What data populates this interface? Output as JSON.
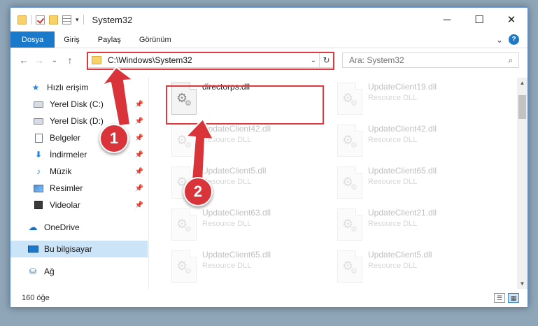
{
  "window": {
    "title": "System32",
    "controls": {
      "minimize": "─",
      "maximize": "☐",
      "close": "✕"
    }
  },
  "ribbon": {
    "tabs": [
      {
        "label": "Dosya"
      },
      {
        "label": "Giriş"
      },
      {
        "label": "Paylaş"
      },
      {
        "label": "Görünüm"
      }
    ],
    "expand_glyph": "⌄",
    "help_glyph": "?"
  },
  "nav": {
    "back": "←",
    "forward": "→",
    "recent": "⌄",
    "up": "↑",
    "address": "C:\\Windows\\System32",
    "address_dropdown": "⌄",
    "refresh": "↻",
    "search_placeholder": "Ara: System32",
    "search_glyph": "⌕"
  },
  "sidebar": {
    "items": [
      {
        "label": "Hızlı erişim",
        "icon": "star-icon",
        "glyph": "★"
      },
      {
        "label": "Yerel Disk (C:)",
        "icon": "disk-icon",
        "pinned": true
      },
      {
        "label": "Yerel Disk (D:)",
        "icon": "disk-icon",
        "pinned": true
      },
      {
        "label": "Belgeler",
        "icon": "document-icon",
        "pinned": true
      },
      {
        "label": "İndirmeler",
        "icon": "download-icon",
        "glyph": "⬇",
        "pinned": true
      },
      {
        "label": "Müzik",
        "icon": "music-icon",
        "glyph": "♪",
        "pinned": true
      },
      {
        "label": "Resimler",
        "icon": "pictures-icon",
        "pinned": true
      },
      {
        "label": "Videolar",
        "icon": "video-icon",
        "pinned": true
      },
      {
        "label": "OneDrive",
        "icon": "cloud-icon",
        "glyph": "☁"
      },
      {
        "label": "Bu bilgisayar",
        "icon": "computer-icon",
        "selected": true
      },
      {
        "label": "Ağ",
        "icon": "network-icon",
        "glyph": "⛁"
      }
    ],
    "pin_glyph": "📌"
  },
  "files": [
    {
      "name": "directorps.dll",
      "type": "",
      "highlighted": true
    },
    {
      "name": "UpdateClient19.dll",
      "type": "Resource DLL"
    },
    {
      "name": "UpdateClient42.dll",
      "type": "Resource DLL"
    },
    {
      "name": "UpdateClient42.dll",
      "type": "Resource DLL"
    },
    {
      "name": "UpdateClient5.dll",
      "type": "Resource DLL"
    },
    {
      "name": "UpdateClient65.dll",
      "type": "Resource DLL"
    },
    {
      "name": "UpdateClient63.dll",
      "type": "Resource DLL"
    },
    {
      "name": "UpdateClient21.dll",
      "type": "Resource DLL"
    },
    {
      "name": "UpdateClient65.dll",
      "type": "Resource DLL"
    },
    {
      "name": "UpdateClient5.dll",
      "type": "Resource DLL"
    }
  ],
  "status": {
    "item_count": "160 öğe"
  },
  "callouts": {
    "step1": "1",
    "step2": "2",
    "color": "#d9343a"
  },
  "colors": {
    "accent": "#1979ca",
    "selection": "#cce4f7",
    "highlight_border": "#e0383e"
  }
}
